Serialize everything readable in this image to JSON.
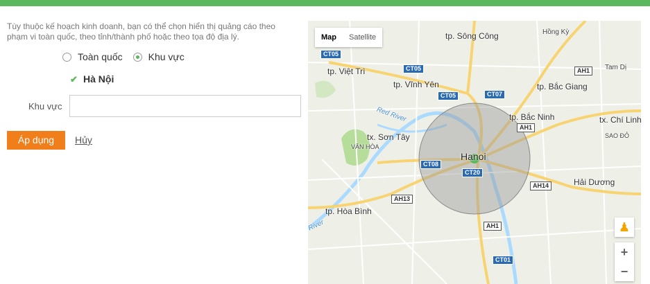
{
  "description": "Tùy thuộc kế hoạch kinh doanh, bạn có thể chọn hiển thị quảng cáo theo phạm vi toàn quốc, theo tỉnh/thành phố hoặc theo tọa độ địa lý.",
  "scope_options": [
    {
      "label": "Toàn quốc",
      "selected": false
    },
    {
      "label": "Khu vực",
      "selected": true
    }
  ],
  "selected_region": {
    "label": "Hà Nội",
    "checked": true
  },
  "region_field": {
    "label": "Khu vực",
    "value": ""
  },
  "buttons": {
    "apply": "Áp dụng",
    "cancel": "Hủy"
  },
  "map": {
    "type_options": [
      "Map",
      "Satellite"
    ],
    "active_type": "Map",
    "zoom_in": "+",
    "zoom_out": "−",
    "labels": {
      "song_cong": "tp. Sông Công",
      "hong_ky": "Hồng Kỳ",
      "viet_tri": "tp. Việt Trì",
      "tam_di": "Tam Dị",
      "vinh_yen": "tp. Vĩnh Yên",
      "bac_giang": "tp. Bắc Giang",
      "red_river": "Red River",
      "bac_ninh": "tp. Bắc Ninh",
      "chi_linh": "tx. Chí Linh",
      "son_tay": "tx. Sơn Tây",
      "sao_do": "SAO ĐỎ",
      "van_hoa": "VÂN HÒA",
      "hanoi": "Hanoi",
      "hai_duong": "Hải Dương",
      "hoa_binh": "tp. Hòa Bình",
      "river_left": "River"
    },
    "roads": {
      "ct05a": "CT05",
      "ct05b": "CT05",
      "ct05c": "CT05",
      "ct07": "CT07",
      "ct08": "CT08",
      "ct20": "CT20",
      "ct01": "CT01",
      "ah1a": "AH1",
      "ah1b": "AH1",
      "ah1c": "AH1",
      "ah14": "AH14",
      "ah13": "AH13"
    },
    "colors": {
      "land": "#eef0e8",
      "highway": "#f7d372",
      "road": "#ffffff",
      "river": "#aadaff",
      "park": "#b7dd9a",
      "radius": "#9a9a9a",
      "marker": "#5cb85c"
    }
  }
}
